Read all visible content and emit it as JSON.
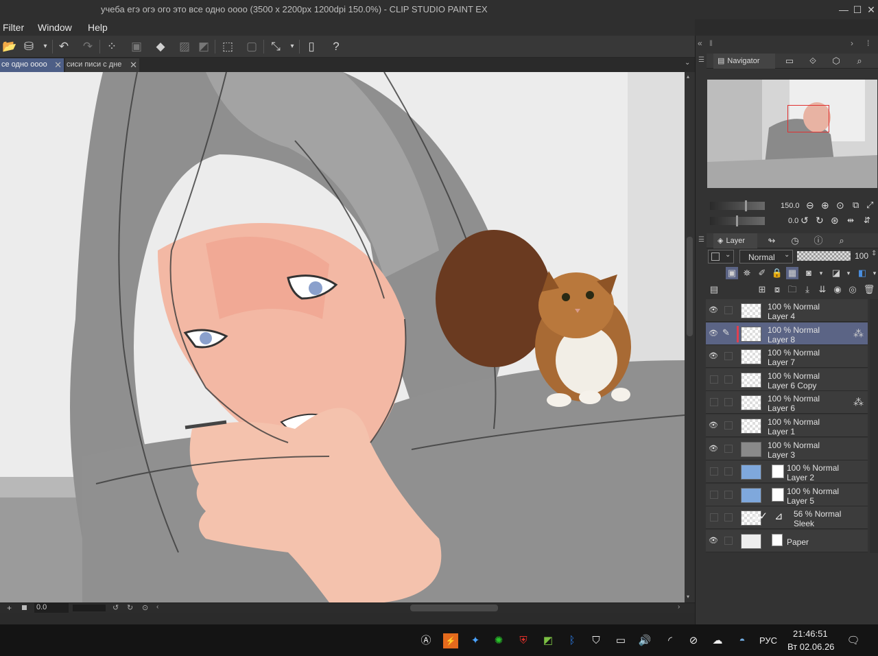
{
  "window": {
    "title": "учеба егэ огэ ого это все одно оооо (3500 x 2200px 1200dpi 150.0%)  - CLIP STUDIO PAINT EX",
    "min": "—",
    "max": "☐",
    "close": "✕"
  },
  "menu": [
    "Filter",
    "Window",
    "Help"
  ],
  "tabs": [
    {
      "label": "се одно оооо",
      "close": "✕"
    },
    {
      "label": "сиси писи с дне",
      "close": "✕"
    }
  ],
  "navigator": {
    "tab_label": "Navigator",
    "zoom_value": "150.0",
    "rotate_value": "0.0"
  },
  "layer_panel": {
    "tab_label": "Layer",
    "blend_mode": "Normal",
    "opacity": "100",
    "layers": [
      {
        "opacity": "100 %",
        "mode": "Normal",
        "name": "Layer 4",
        "visible": true,
        "selected": false,
        "mask": false,
        "ref": false,
        "kind": "raster"
      },
      {
        "opacity": "100 %",
        "mode": "Normal",
        "name": "Layer 8",
        "visible": true,
        "selected": true,
        "mask": false,
        "ref": true,
        "kind": "raster"
      },
      {
        "opacity": "100 %",
        "mode": "Normal",
        "name": "Layer 7",
        "visible": true,
        "selected": false,
        "mask": false,
        "ref": false,
        "kind": "raster"
      },
      {
        "opacity": "100 %",
        "mode": "Normal",
        "name": "Layer 6 Copy",
        "visible": false,
        "selected": false,
        "mask": false,
        "ref": false,
        "kind": "raster"
      },
      {
        "opacity": "100 %",
        "mode": "Normal",
        "name": "Layer 6",
        "visible": false,
        "selected": false,
        "mask": false,
        "ref": true,
        "kind": "raster"
      },
      {
        "opacity": "100 %",
        "mode": "Normal",
        "name": "Layer 1",
        "visible": true,
        "selected": false,
        "mask": false,
        "ref": false,
        "kind": "raster"
      },
      {
        "opacity": "100 %",
        "mode": "Normal",
        "name": "Layer 3",
        "visible": true,
        "selected": false,
        "mask": false,
        "ref": false,
        "kind": "raster"
      },
      {
        "opacity": "100 %",
        "mode": "Normal",
        "name": "Layer 2",
        "visible": false,
        "selected": false,
        "mask": true,
        "ref": false,
        "kind": "image"
      },
      {
        "opacity": "100 %",
        "mode": "Normal",
        "name": "Layer 5",
        "visible": false,
        "selected": false,
        "mask": true,
        "ref": false,
        "kind": "image"
      },
      {
        "opacity": "56 %",
        "mode": "Normal",
        "name": "Sleek",
        "visible": false,
        "selected": false,
        "mask": false,
        "ref": false,
        "kind": "tone"
      },
      {
        "opacity": "",
        "mode": "",
        "name": "Paper",
        "visible": true,
        "selected": false,
        "mask": false,
        "ref": false,
        "kind": "paper"
      }
    ]
  },
  "statusbar": {
    "angle": "0.0"
  },
  "taskbar": {
    "lang": "РУС",
    "time": "21:46:51",
    "date": "Вт 02.06.26",
    "colors": {
      "bg": "#141414"
    }
  },
  "colors": {
    "accent_selected": "#5b6485",
    "panel": "#333333",
    "canvas": "#e9e9e9"
  }
}
